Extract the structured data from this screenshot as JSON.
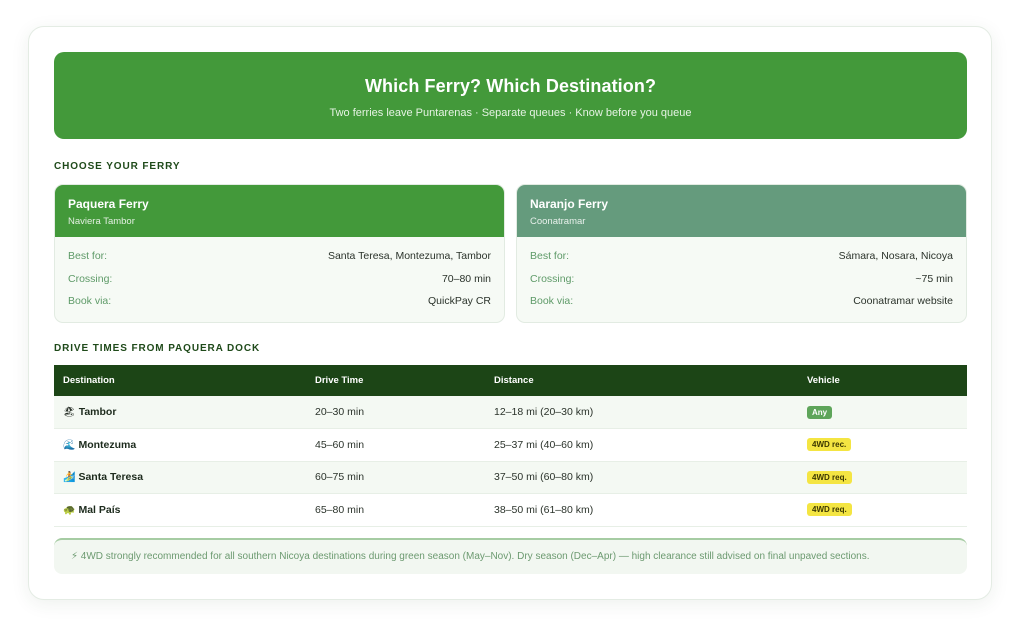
{
  "header": {
    "title": "Which Ferry? Which Destination?",
    "subtitle": "Two ferries leave Puntarenas · Separate queues · Know before you queue"
  },
  "choose_label": "CHOOSE YOUR FERRY",
  "ferries": [
    {
      "name": "Paquera Ferry",
      "operator": "Naviera Tambor",
      "header_color": "#43993a",
      "rows": [
        {
          "key": "Best for:",
          "value": "Santa Teresa, Montezuma, Tambor"
        },
        {
          "key": "Crossing:",
          "value": "70–80 min"
        },
        {
          "key": "Book via:",
          "value": "QuickPay CR"
        }
      ]
    },
    {
      "name": "Naranjo Ferry",
      "operator": "Coonatramar",
      "header_color": "#659b7d",
      "rows": [
        {
          "key": "Best for:",
          "value": "Sámara, Nosara, Nicoya"
        },
        {
          "key": "Crossing:",
          "value": "~75 min"
        },
        {
          "key": "Book via:",
          "value": "Coonatramar website"
        }
      ]
    }
  ],
  "drive_label": "DRIVE TIMES FROM PAQUERA DOCK",
  "table": {
    "headers": [
      "Destination",
      "Drive Time",
      "Distance",
      "Vehicle"
    ],
    "rows": [
      {
        "emoji": "🏖",
        "destination": "Tambor",
        "drive_time": "20–30 min",
        "distance": "12–18 mi (20–30 km)",
        "vehicle": "Any",
        "vehicle_style": "any"
      },
      {
        "emoji": "🌊",
        "destination": "Montezuma",
        "drive_time": "45–60 min",
        "distance": "25–37 mi (40–60 km)",
        "vehicle": "4WD rec.",
        "vehicle_style": "warn"
      },
      {
        "emoji": "🏄",
        "destination": "Santa Teresa",
        "drive_time": "60–75 min",
        "distance": "37–50 mi (60–80 km)",
        "vehicle": "4WD req.",
        "vehicle_style": "warn"
      },
      {
        "emoji": "🐢",
        "destination": "Mal País",
        "drive_time": "65–80 min",
        "distance": "38–50 mi (61–80 km)",
        "vehicle": "4WD req.",
        "vehicle_style": "warn"
      }
    ]
  },
  "note": "⚡ 4WD strongly recommended for all southern Nicoya destinations during green season (May–Nov). Dry season (Dec–Apr) — high clearance still advised on final unpaved sections."
}
